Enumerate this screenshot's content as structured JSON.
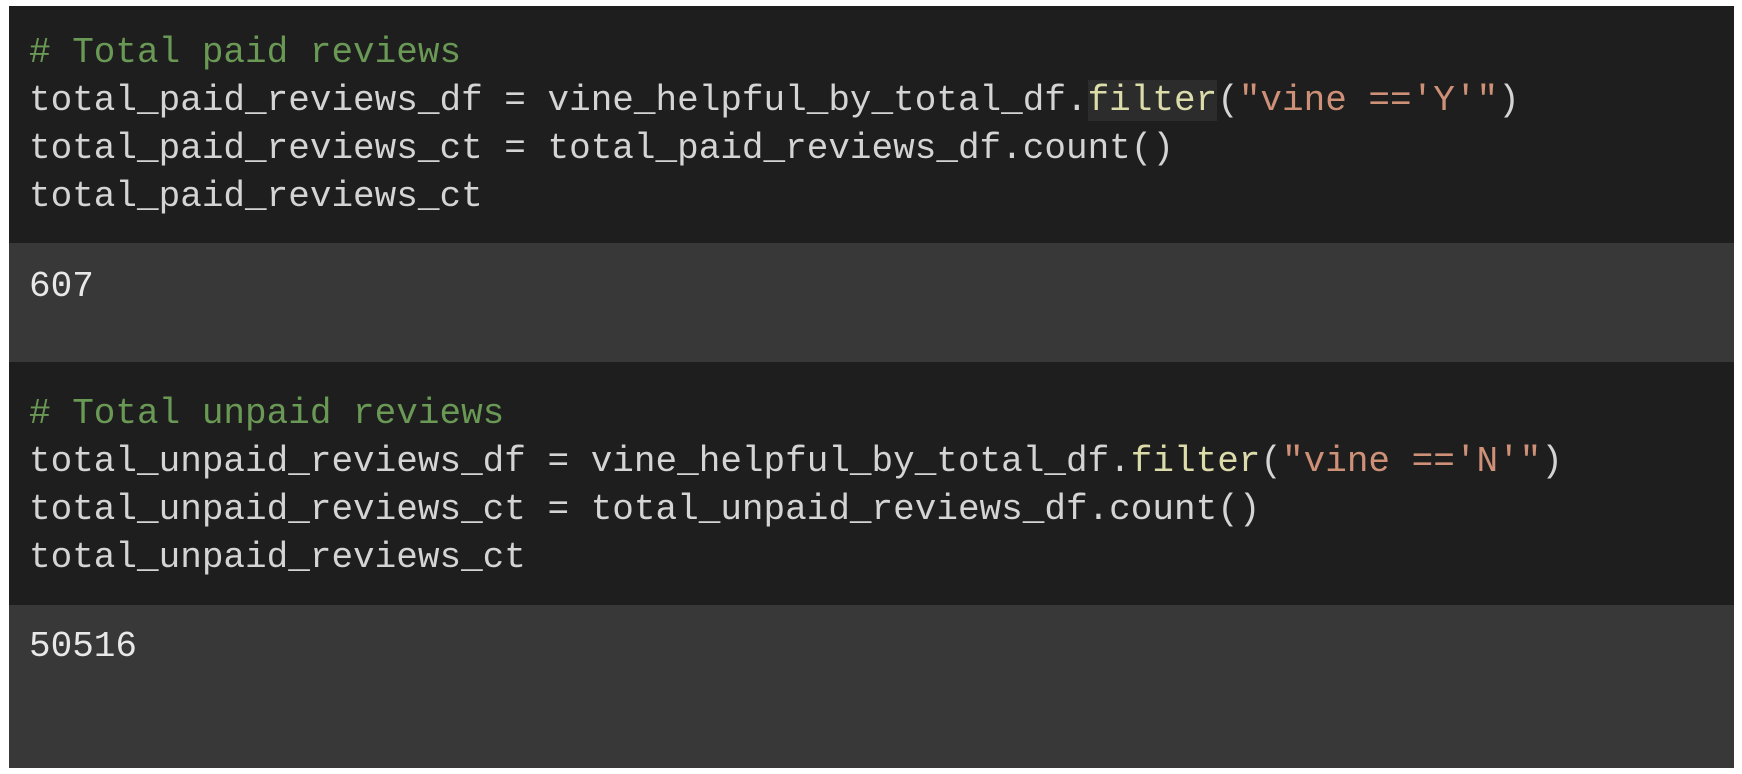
{
  "cells": [
    {
      "comment": "# Total paid reviews",
      "line1": {
        "lhs": "total_paid_reviews_df = vine_helpful_by_total_df.",
        "func": "filter",
        "open": "(",
        "str": "\"vine =='Y'\"",
        "close": ")"
      },
      "line2": "total_paid_reviews_ct = total_paid_reviews_df.count()",
      "line3": "total_paid_reviews_ct",
      "output": "607"
    },
    {
      "comment": "# Total unpaid reviews",
      "line1": {
        "lhs": "total_unpaid_reviews_df = vine_helpful_by_total_df.",
        "func": "filter",
        "open": "(",
        "str": "\"vine =='N'\"",
        "close": ")"
      },
      "line2": "total_unpaid_reviews_ct = total_unpaid_reviews_df.count()",
      "line3": "total_unpaid_reviews_ct",
      "output": "50516"
    }
  ],
  "colors": {
    "code_bg": "#1e1e1e",
    "output_bg": "#383838",
    "comment": "#6a9955",
    "function": "#dcdcaa",
    "string": "#ce9178",
    "default": "#d4d4d4"
  }
}
